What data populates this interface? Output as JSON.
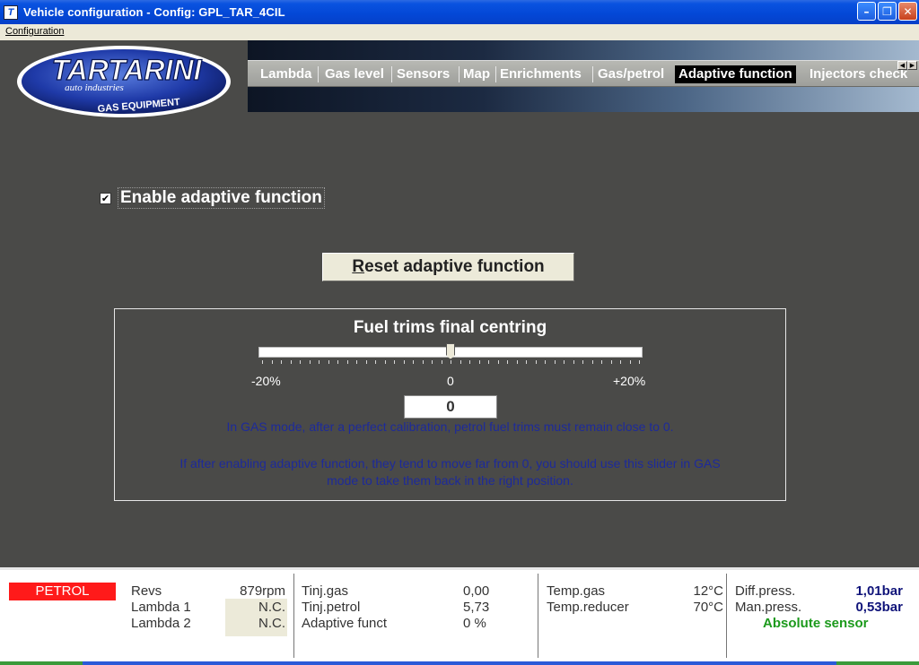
{
  "window": {
    "icon_letter": "T",
    "title": "Vehicle configuration - Config: GPL_TAR_4CIL",
    "buttons": [
      "minimize-icon",
      "restore-icon",
      "close-icon"
    ]
  },
  "menu": {
    "items": [
      "Configuration"
    ]
  },
  "logo": {
    "brand": "TARTARINI",
    "tagline": "auto industries",
    "sub": "GAS EQUIPMENT",
    "colors": {
      "oval": "#1f3aa8",
      "border": "#ffffff"
    }
  },
  "tabs": [
    {
      "label": "Lambda",
      "active": false
    },
    {
      "label": "Gas level",
      "active": false
    },
    {
      "label": "Sensors",
      "active": false
    },
    {
      "label": "Map",
      "active": false
    },
    {
      "label": "Enrichments",
      "active": false
    },
    {
      "label": "Gas/petrol",
      "active": false
    },
    {
      "label": "Adaptive function",
      "active": true
    },
    {
      "label": "Injectors check",
      "active": false
    }
  ],
  "main": {
    "enable_checkbox": {
      "label": "Enable adaptive function",
      "checked": true
    },
    "reset_button": {
      "label": "Reset adaptive function",
      "mnemonic": "R"
    },
    "trim": {
      "title": "Fuel trims final centring",
      "scale_min": "-20%",
      "scale_mid": "0",
      "scale_max": "+20%",
      "slider_value_percent": 0,
      "value": "0",
      "note1": "In GAS mode, after a perfect calibration, petrol fuel trims must remain close to 0.",
      "note2_line1": "If after enabling adaptive function, they tend to move far from 0, you should use this slider in GAS",
      "note2_line2": "mode to take them back in the right position."
    }
  },
  "status": {
    "mode": "PETROL",
    "mode_color": "#ff1a1a",
    "revs_label": "Revs",
    "revs_value": "879rpm",
    "lambda1_label": "Lambda 1",
    "lambda1_value": "N.C.",
    "lambda2_label": "Lambda 2",
    "lambda2_value": "N.C.",
    "tinj_gas_label": "Tinj.gas",
    "tinj_gas_value": "0,00",
    "tinj_petrol_label": "Tinj.petrol",
    "tinj_petrol_value": "5,73",
    "adaptive_label": "Adaptive funct",
    "adaptive_value": "0 %",
    "temp_gas_label": "Temp.gas",
    "temp_gas_value": "12°C",
    "temp_reducer_label": "Temp.reducer",
    "temp_reducer_value": "70°C",
    "diff_press_label": "Diff.press.",
    "diff_press_value": "1,01bar",
    "man_press_label": "Man.press.",
    "man_press_value": "0,53bar",
    "sensor_type": "Absolute sensor"
  }
}
